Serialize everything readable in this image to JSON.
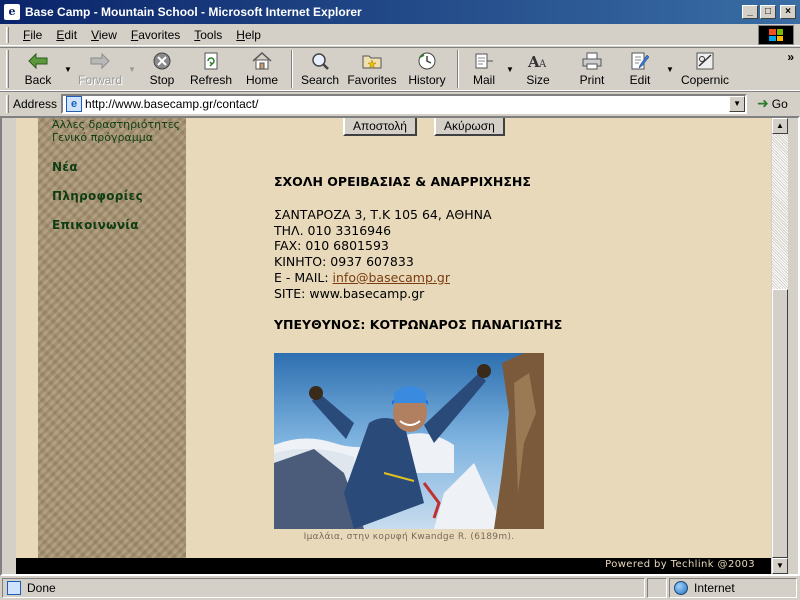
{
  "window": {
    "title": "Base Camp - Mountain School - Microsoft Internet Explorer",
    "app_icon": "e",
    "minimize": "_",
    "maximize": "□",
    "close": "×"
  },
  "menu": {
    "items": [
      {
        "key": "F",
        "rest": "ile"
      },
      {
        "key": "E",
        "rest": "dit"
      },
      {
        "key": "V",
        "rest": "iew"
      },
      {
        "key": "F",
        "rest": "avorites"
      },
      {
        "key": "T",
        "rest": "ools"
      },
      {
        "key": "H",
        "rest": "elp"
      }
    ]
  },
  "toolbar": {
    "back": "Back",
    "forward": "Forward",
    "stop": "Stop",
    "refresh": "Refresh",
    "home": "Home",
    "search": "Search",
    "favorites": "Favorites",
    "history": "History",
    "mail": "Mail",
    "size": "Size",
    "print": "Print",
    "edit": "Edit",
    "copernic": "Copernic",
    "more": "»"
  },
  "address": {
    "label": "Address",
    "url": "http://www.basecamp.gr/contact/",
    "go": "Go"
  },
  "page": {
    "sidebar": {
      "other_activities": "Άλλες δραστηριότητες",
      "general_program": "Γενικό πρόγραμμα",
      "news": "Νέα",
      "information": "Πληροφορίες",
      "contact": "Επικοινωνία"
    },
    "form": {
      "send": "Αποστολή",
      "cancel": "Ακύρωση"
    },
    "contact": {
      "school_name": "ΣΧΟΛΗ ΟΡΕΙΒΑΣΙΑΣ & ΑΝΑΡΡΙΧΗΣΗΣ",
      "address": "ΣΑΝΤΑΡΟΖΑ 3, Τ.Κ 105 64, ΑΘΗΝΑ",
      "phone": "ΤΗΛ. 010 3316946",
      "fax": "FAX: 010 6801593",
      "mobile": "ΚΙΝΗΤΟ: 0937 607833",
      "email_label": "E - MAIL: ",
      "email": "info@basecamp.gr",
      "site": "SITE: www.basecamp.gr",
      "responsible": "ΥΠΕΥΘΥΝΟΣ: ΚΟΤΡΩΝΑΡΟΣ ΠΑΝΑΓΙΩΤΗΣ"
    },
    "photo_caption": "Ιμαλάια, στην κορυφή Kwandge R. (6189m).",
    "footer_credit": "Powered by Techlink @2003"
  },
  "status": {
    "text": "Done",
    "zone": "Internet"
  },
  "colors": {
    "page_bg": "#e8d9bb",
    "sidebar_texture": "#a79270",
    "nav_link": "#0f3d13",
    "email_link": "#7a3c10",
    "title_bar": "#0a246a"
  }
}
